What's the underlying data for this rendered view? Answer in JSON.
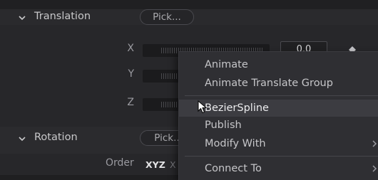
{
  "translation": {
    "title": "Translation",
    "pick_label": "Pick...",
    "axes": [
      {
        "label": "X",
        "value": "0.0"
      },
      {
        "label": "Y",
        "value": ""
      },
      {
        "label": "Z",
        "value": ""
      }
    ]
  },
  "rotation": {
    "title": "Rotation",
    "pick_label": "Pick..",
    "order_label": "Order",
    "order_value": "XYZ",
    "order_value_next": "X"
  },
  "context_menu": {
    "items": [
      {
        "label": "Animate"
      },
      {
        "label": "Animate Translate Group"
      },
      {
        "label": "BezierSpline",
        "highlighted": true
      },
      {
        "label": "Publish"
      },
      {
        "label": "Modify With",
        "has_submenu": true
      },
      {
        "label": "Connect To",
        "has_submenu": true
      }
    ]
  },
  "colors": {
    "panel_bg": "#27272a",
    "menu_bg": "#2f2f33",
    "highlight_bg": "#3c3c41"
  },
  "icons": [
    "chevron-down-icon",
    "keyframe-diamond-icon",
    "chevron-right-icon",
    "mouse-pointer-icon"
  ]
}
